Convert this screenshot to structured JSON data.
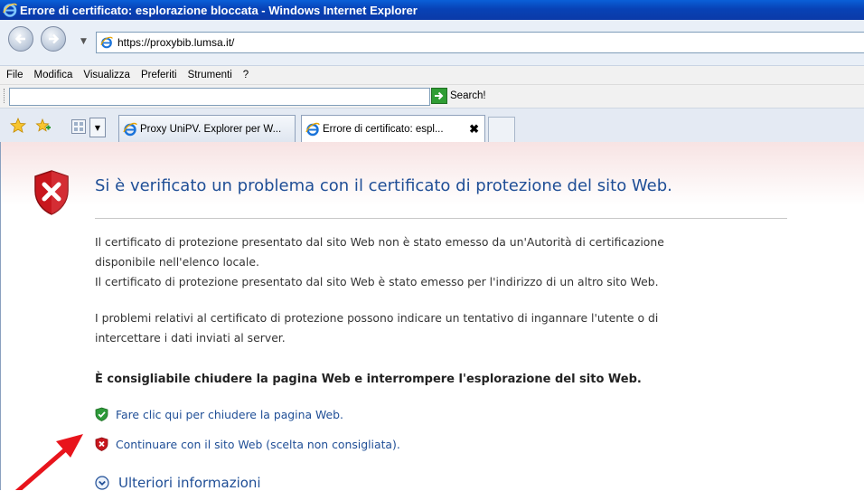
{
  "window": {
    "title": "Errore di certificato: esplorazione bloccata - Windows Internet Explorer"
  },
  "address": {
    "url": "https://proxybib.lumsa.it/"
  },
  "menu": {
    "items": [
      "File",
      "Modifica",
      "Visualizza",
      "Preferiti",
      "Strumenti",
      "?"
    ]
  },
  "search": {
    "value": "",
    "button_label": "Search!"
  },
  "tabs": [
    {
      "label": "Proxy UniPV. Explorer per W..."
    },
    {
      "label": "Errore di certificato: espl...",
      "close": "✖"
    }
  ],
  "page": {
    "heading": "Si è verificato un problema con il certificato di protezione del sito Web.",
    "para1_line1": "Il certificato di protezione presentato dal sito Web non è stato emesso da un'Autorità di certificazione",
    "para1_line2": "disponibile nell'elenco locale.",
    "para1_line3": "Il certificato di protezione presentato dal sito Web è stato emesso per l'indirizzo di un altro sito Web.",
    "para2_line1": "I problemi relativi al certificato di protezione possono indicare un tentativo di ingannare l'utente o di",
    "para2_line2": "intercettare i dati inviati al server.",
    "recommendation": "È consigliabile chiudere la pagina Web e interrompere l'esplorazione del sito Web.",
    "close_link": "Fare clic qui per chiudere la pagina Web.",
    "continue_link": "Continuare con il sito Web (scelta non consigliata).",
    "more_info": "Ulteriori informazioni"
  },
  "colors": {
    "link": "#1f4e96",
    "error_red": "#c8171e",
    "arrow": "#e8141c"
  }
}
